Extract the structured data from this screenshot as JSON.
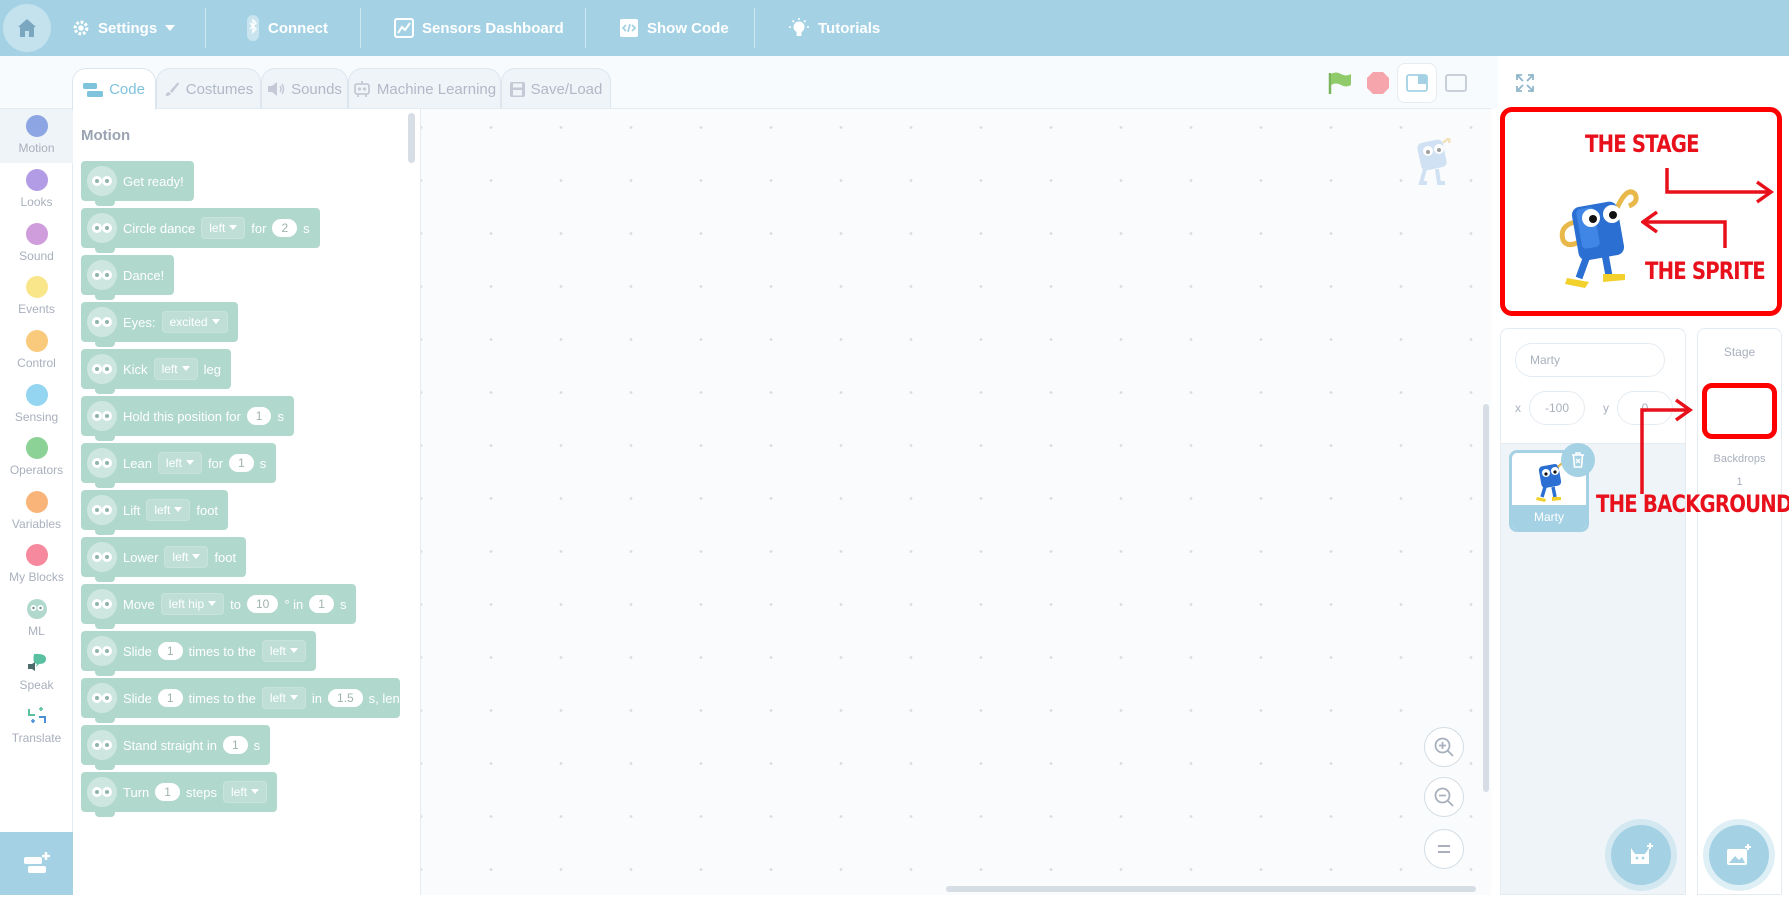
{
  "menubar": {
    "settings_label": "Settings",
    "connect_label": "Connect",
    "sensors_label": "Sensors Dashboard",
    "showcode_label": "Show Code",
    "tutorials_label": "Tutorials"
  },
  "tabs": {
    "code": "Code",
    "costumes": "Costumes",
    "sounds": "Sounds",
    "ml": "Machine Learning",
    "saveload": "Save/Load"
  },
  "categories": [
    {
      "label": "Motion",
      "color": "#4c6fd6"
    },
    {
      "label": "Looks",
      "color": "#7e5ad6"
    },
    {
      "label": "Sound",
      "color": "#b05cc4"
    },
    {
      "label": "Events",
      "color": "#f5d63d"
    },
    {
      "label": "Control",
      "color": "#f5a623"
    },
    {
      "label": "Sensing",
      "color": "#4cb9e8"
    },
    {
      "label": "Operators",
      "color": "#3fb34f"
    },
    {
      "label": "Variables",
      "color": "#f5841f"
    },
    {
      "label": "My Blocks",
      "color": "#f03a5c"
    },
    {
      "label": "ML",
      "color": "#7ec9b3"
    },
    {
      "label": "Speak",
      "color": "#3aa68a"
    },
    {
      "label": "Translate",
      "color": "#3aa68a"
    }
  ],
  "palette": {
    "title": "Motion",
    "blocks": {
      "get_ready": "Get ready!",
      "circle_dance": "Circle dance",
      "circle_dir": "left",
      "circle_for": "for",
      "circle_val": "2",
      "circle_unit": "s",
      "dance": "Dance!",
      "eyes": "Eyes:",
      "eyes_val": "excited",
      "kick": "Kick",
      "kick_dir": "left",
      "kick_unit": "leg",
      "hold": "Hold this position for",
      "hold_val": "1",
      "hold_unit": "s",
      "lean": "Lean",
      "lean_dir": "left",
      "lean_for": "for",
      "lean_val": "1",
      "lean_unit": "s",
      "lift": "Lift",
      "lift_dir": "left",
      "lift_unit": "foot",
      "lower": "Lower",
      "lower_dir": "left",
      "lower_unit": "foot",
      "move": "Move",
      "move_joint": "left hip",
      "move_to": "to",
      "move_val": "10",
      "move_in": "° in",
      "move_time": "1",
      "move_unit": "s",
      "slide1": "Slide",
      "slide1_val": "1",
      "slide1_text": "times to the",
      "slide1_dir": "left",
      "slide2": "Slide",
      "slide2_val": "1",
      "slide2_text": "times to the",
      "slide2_dir": "left",
      "slide2_in": "in",
      "slide2_time": "1.5",
      "slide2_tail": "s, len",
      "stand": "Stand straight in",
      "stand_val": "1",
      "stand_unit": "s",
      "turn": "Turn",
      "turn_val": "1",
      "turn_text": "steps",
      "turn_dir": "left"
    }
  },
  "annotations": {
    "stage": "The Stage",
    "sprite": "The Sprite",
    "background": "The Background"
  },
  "sprite_info": {
    "name_value": "Marty",
    "x_label": "x",
    "x_value": "-100",
    "y_label": "y",
    "y_value": "0"
  },
  "sprite_list": {
    "sprite_name": "Marty"
  },
  "stage_panel": {
    "title": "Stage",
    "backdrops_label": "Backdrops",
    "backdrops_count": "1"
  }
}
